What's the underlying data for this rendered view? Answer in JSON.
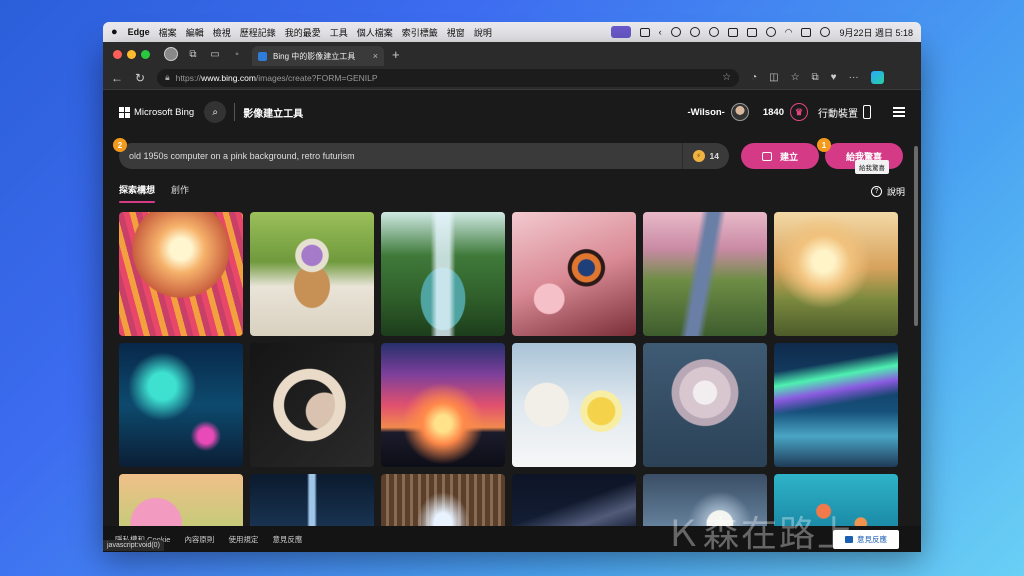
{
  "menubar": {
    "apple": "",
    "app": "Edge",
    "items": [
      "檔案",
      "編輯",
      "檢視",
      "歷程記錄",
      "我的最愛",
      "工具",
      "個人檔案",
      "索引標籤",
      "視窗",
      "說明"
    ],
    "datetime": "9月22日 週日  5:18"
  },
  "browser": {
    "tab_title": "Bing 中的影像建立工具",
    "tab_close": "×",
    "new_tab": "+",
    "url_scheme": "https://",
    "url_host": "www.bing.com",
    "url_path": "/images/create?FORM=GENILP"
  },
  "header": {
    "brand": "Microsoft Bing",
    "tool_title": "影像建立工具",
    "user_name": "-Wilson-",
    "points": "1840",
    "mobile_label": "行動裝置"
  },
  "prompt": {
    "text": "old 1950s computer on a pink background, retro futurism",
    "boost_count": "14",
    "create_label": "建立",
    "surprise_label": "給我驚喜",
    "tooltip": "給我驚喜",
    "badge_1": "1",
    "badge_2": "2"
  },
  "tabs": {
    "explore": "探索構想",
    "creations": "創作",
    "help": "說明"
  },
  "gallery": {
    "thumbnails": [
      "tulip-field-sunset",
      "picnic-flower-basket",
      "waterfall-rainbow",
      "butterfly-cherry-blossom",
      "cherry-blossom-stream",
      "park-kite-sunset",
      "fantasy-glowing-forest",
      "crescent-moon-flowers",
      "rider-silhouette-sunset",
      "polar-bears-lemonade",
      "white-flower-bouquet",
      "aurora-coast",
      "pink-tree-garden",
      "night-city-tower",
      "library-corridor",
      "milky-way-night",
      "full-moon-ocean",
      "underwater-jellyfish"
    ]
  },
  "footer": {
    "items": [
      "隱私權和 Cookie",
      "內容原則",
      "使用規定",
      "意見反應"
    ],
    "feedback_button": "意見反應",
    "status_text": "javascript:void(0)",
    "watermark": "Ｋ森在路上"
  },
  "colors": {
    "accent_pink": "#d43a86",
    "badge_orange": "#f29a1c",
    "page_bg": "#1b1a1a"
  }
}
